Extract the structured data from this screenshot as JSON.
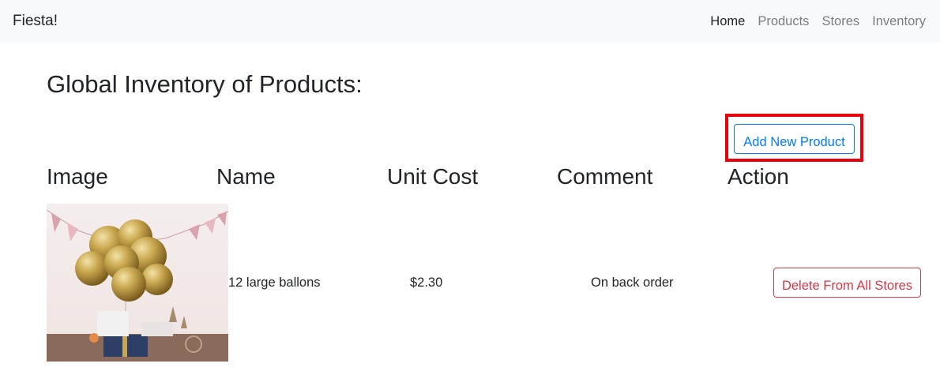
{
  "navbar": {
    "brand": "Fiesta!",
    "links": [
      {
        "label": "Home",
        "active": true
      },
      {
        "label": "Products",
        "active": false
      },
      {
        "label": "Stores",
        "active": false
      },
      {
        "label": "Inventory",
        "active": false
      }
    ]
  },
  "page": {
    "title": "Global Inventory of Products:"
  },
  "actions": {
    "add_label": "Add New Product"
  },
  "table": {
    "headers": [
      "Image",
      "Name",
      "Unit Cost",
      "Comment",
      "Action"
    ],
    "rows": [
      {
        "image_icon": "gold-balloons-image",
        "name": "12 large ballons",
        "unit_cost": "$2.30",
        "comment": "On back order",
        "action_label": "Delete From All Stores"
      }
    ]
  },
  "colors": {
    "primary": "#007bff",
    "danger": "#dc3545",
    "highlight": "#e8000b",
    "navbar_bg": "#f8f9fa"
  }
}
